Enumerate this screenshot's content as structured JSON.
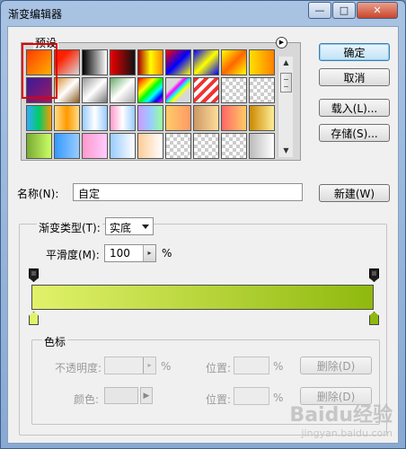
{
  "window": {
    "title": "渐变编辑器",
    "controls": {
      "minimize": "—",
      "maximize": "□",
      "close": "✕"
    }
  },
  "presets": {
    "label": "预设",
    "menu_arrow": "▶",
    "swatches_row1": [
      "#ff6a00",
      "checker-red",
      "#000000",
      "#e02020",
      "#d32d00",
      "#2040ff",
      "#1a2fb0",
      "#ffcc00",
      "#ffe400"
    ],
    "colors": {
      "r1": [
        "linear-gradient(135deg,#ff3b00,#ffb000)",
        "linear-gradient(135deg,#ff2000 30%,transparent)",
        "linear-gradient(90deg,#000,#fff)",
        "linear-gradient(90deg,#e00,#111)",
        "linear-gradient(90deg,#a00,#ff0,#f80)",
        "linear-gradient(135deg,#f00,#00f,#ff0)",
        "linear-gradient(135deg,#00f,#ff0,#00f)",
        "linear-gradient(135deg,#ff0,#f60,#ff0)",
        "linear-gradient(90deg,#ffe000,#ff8000)"
      ],
      "r2": [
        "linear-gradient(135deg,#3a1a99,#a01a60)",
        "linear-gradient(135deg,#d58a2a,#fff,#8a5a20)",
        "linear-gradient(135deg,#999,#fff,#777)",
        "linear-gradient(135deg,#6a6,#fff,#aaa)",
        "linear-gradient(135deg,#f00,#f80,#ff0,#0f0,#0ff,#00f,#f0f)",
        "linear-gradient(135deg,transparent 30%,#f0f,#0ff,#ff0,transparent 70%)",
        "repeating-linear-gradient(135deg,#e33 0 4px,#fff 4px 8px)",
        "checker",
        "checker"
      ],
      "r3": [
        "linear-gradient(90deg,#3af,#0c6,#f90)",
        "linear-gradient(90deg,#fd8,#f90,#fd8)",
        "linear-gradient(90deg,#9cf,#fff,#9cf)",
        "linear-gradient(90deg,#f9c,#fff,#9cf)",
        "linear-gradient(90deg,#c9f,#9cf,#9f9)",
        "linear-gradient(90deg,#fc6,#f96)",
        "linear-gradient(90deg,#c96,#fd9)",
        "linear-gradient(90deg,#f66,#fc6)",
        "linear-gradient(90deg,#c80,#fe9)"
      ],
      "r4": [
        "linear-gradient(90deg,#7a3,#cf6)",
        "linear-gradient(90deg,#39f,#9cf)",
        "linear-gradient(90deg,#f9c,#fcf)",
        "linear-gradient(90deg,#9cf,#fff)",
        "linear-gradient(90deg,#fc9,#fff)",
        "checker",
        "checker",
        "checker",
        "linear-gradient(90deg,#bbb,#fff)"
      ]
    },
    "scroll_up": "▲",
    "scroll_down": "▼"
  },
  "buttons": {
    "ok": "确定",
    "cancel": "取消",
    "load": "载入(L)...",
    "save": "存储(S)...",
    "new": "新建(W)",
    "delete1": "删除(D)",
    "delete2": "删除(D)"
  },
  "name": {
    "label": "名称(N):",
    "value": "自定"
  },
  "gradient": {
    "type_label": "渐变类型(T):",
    "type_value": "实底",
    "smoothness_label": "平滑度(M):",
    "smoothness_value": "100",
    "smoothness_unit": "%",
    "start_color": "#e1f26a",
    "end_color": "#8fb90e"
  },
  "stops": {
    "group_label": "色标",
    "opacity_label": "不透明度:",
    "opacity_unit": "%",
    "position_label1": "位置:",
    "position_unit1": "%",
    "color_label": "颜色:",
    "position_label2": "位置:",
    "position_unit2": "%"
  },
  "watermark": {
    "big": "Baidu经验",
    "small": "jingyan.baidu.com"
  }
}
